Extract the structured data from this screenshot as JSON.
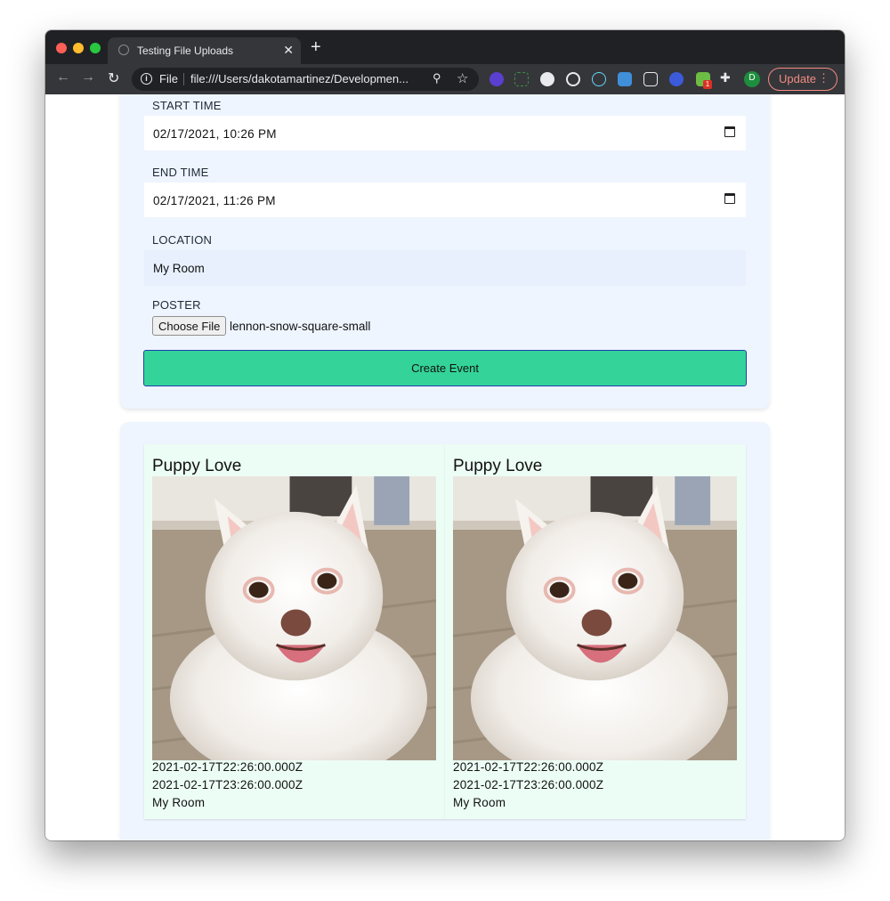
{
  "browser": {
    "tab_title": "Testing File Uploads",
    "scheme": "File",
    "url": "file:///Users/dakotamartinez/Developmen...",
    "update_label": "Update",
    "profile_initial": "D",
    "extension_badge": "1"
  },
  "form": {
    "start_label": "START TIME",
    "start_value": "02/17/2021, 10:26 PM",
    "end_label": "END TIME",
    "end_value": "02/17/2021, 11:26 PM",
    "location_label": "LOCATION",
    "location_value": "My Room",
    "poster_label": "POSTER",
    "choose_file_label": "Choose File",
    "file_name": "lennon-snow-square-small",
    "submit_label": "Create Event"
  },
  "events": [
    {
      "title": "Puppy Love",
      "start": "2021-02-17T22:26:00.000Z",
      "end": "2021-02-17T23:26:00.000Z",
      "location": "My Room"
    },
    {
      "title": "Puppy Love",
      "start": "2021-02-17T22:26:00.000Z",
      "end": "2021-02-17T23:26:00.000Z",
      "location": "My Room"
    }
  ],
  "colors": {
    "accent_button": "#34d399",
    "button_border": "#1e40af",
    "card_bg": "#eef5ff",
    "event_bg": "#ecfdf5"
  }
}
